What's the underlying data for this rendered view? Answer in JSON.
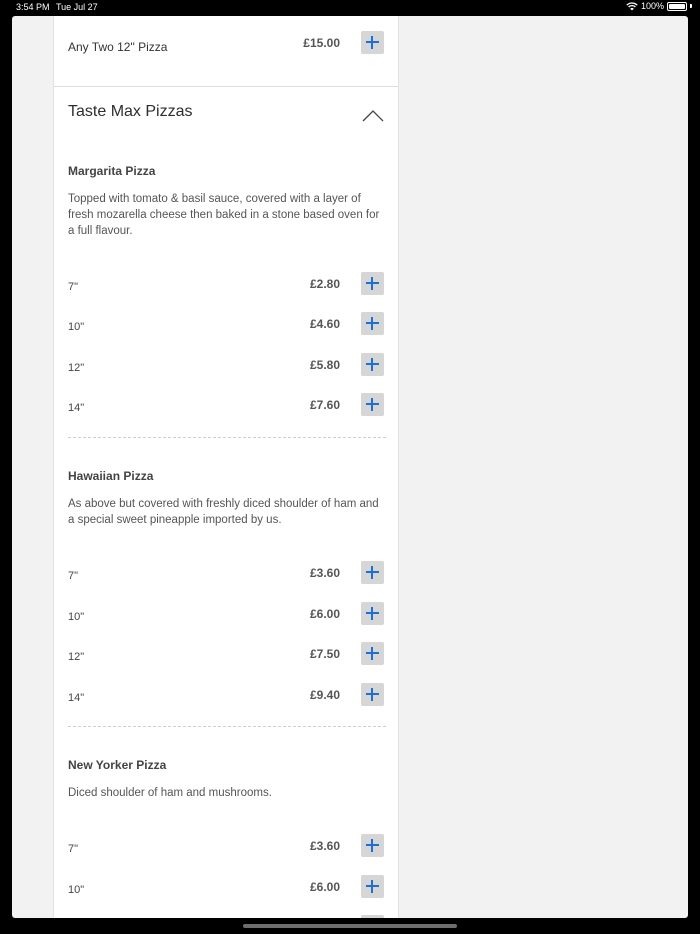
{
  "status_bar": {
    "time": "3:54 PM",
    "date": "Tue Jul 27",
    "battery": "100%"
  },
  "deal": {
    "name": "Any Two 12\" Pizza",
    "price": "£15.00"
  },
  "section": {
    "title": "Taste Max Pizzas"
  },
  "pizzas": [
    {
      "name": "Margarita Pizza",
      "description": "Topped with tomato & basil sauce, covered with a layer of fresh mozarella cheese then baked in a stone based oven for a full flavour.",
      "sizes": [
        {
          "size": "7\"",
          "price": "£2.80"
        },
        {
          "size": "10\"",
          "price": "£4.60"
        },
        {
          "size": "12\"",
          "price": "£5.80"
        },
        {
          "size": "14\"",
          "price": "£7.60"
        }
      ]
    },
    {
      "name": "Hawaiian Pizza",
      "description": "As above but covered with freshly diced shoulder of ham and a special sweet pineapple imported by us.",
      "sizes": [
        {
          "size": "7\"",
          "price": "£3.60"
        },
        {
          "size": "10\"",
          "price": "£6.00"
        },
        {
          "size": "12\"",
          "price": "£7.50"
        },
        {
          "size": "14\"",
          "price": "£9.40"
        }
      ]
    },
    {
      "name": "New Yorker Pizza",
      "description": "Diced shoulder of ham and mushrooms.",
      "sizes": [
        {
          "size": "7\"",
          "price": "£3.60"
        },
        {
          "size": "10\"",
          "price": "£6.00"
        }
      ]
    }
  ]
}
